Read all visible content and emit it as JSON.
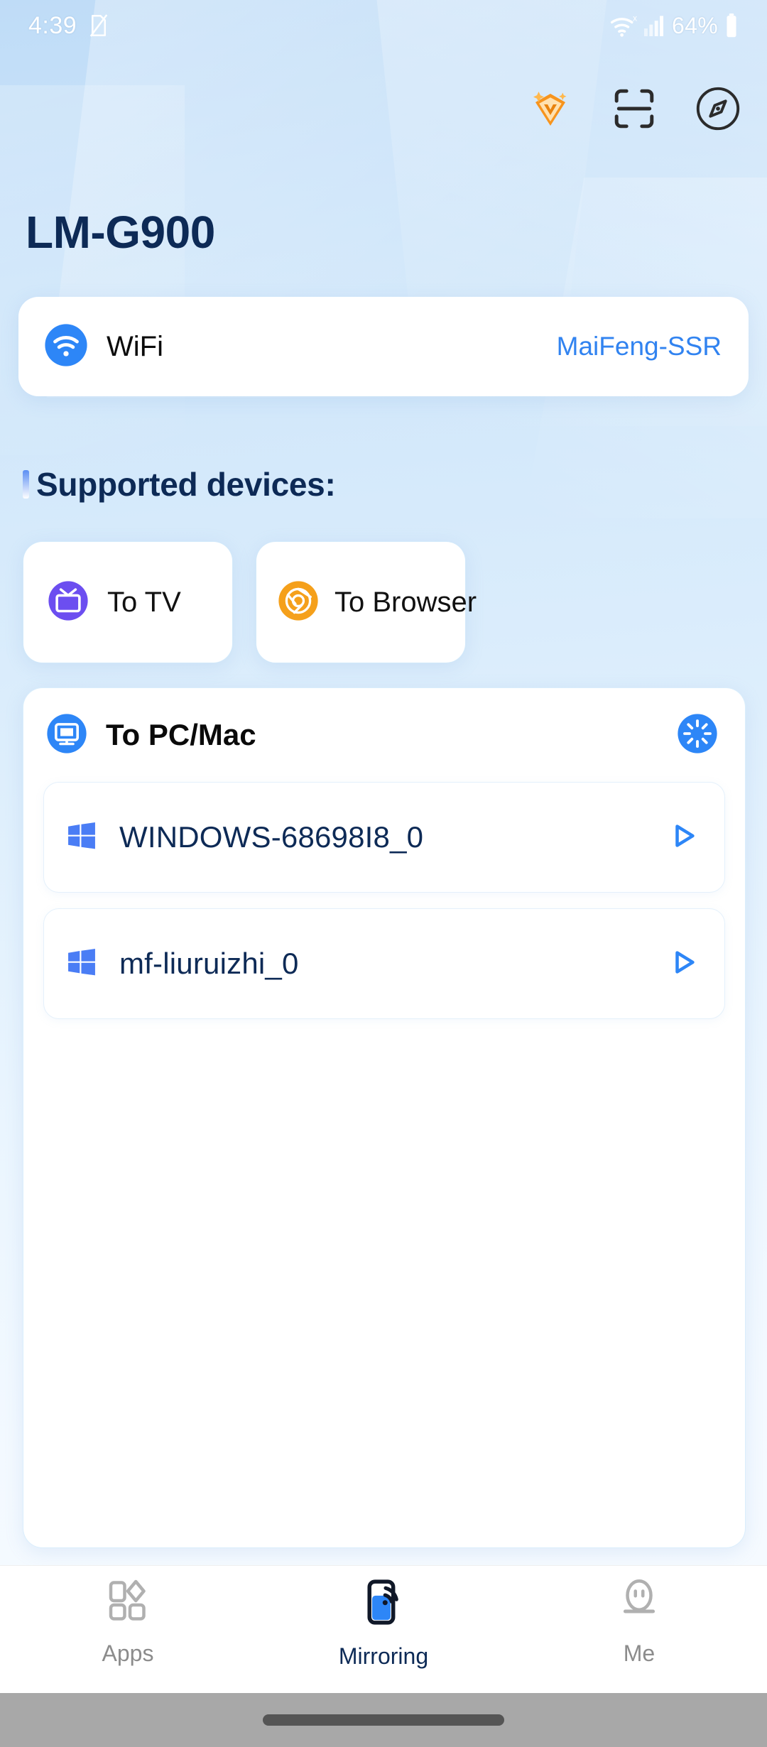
{
  "status_bar": {
    "time": "4:39",
    "no_sim_icon": "no-sim-icon",
    "wifi_icon": "wifi-x-icon",
    "signal_icon": "cellular-signal-icon",
    "battery_percent": "64%",
    "battery_icon": "battery-icon"
  },
  "header": {
    "vip_icon": "vip-diamond-icon",
    "scan_icon": "qr-scan-icon",
    "compass_icon": "compass-icon"
  },
  "device": {
    "name": "LM-G900"
  },
  "wifi": {
    "icon": "wifi-icon",
    "label": "WiFi",
    "ssid": "MaiFeng-SSR",
    "ssid_color": "#3183f0"
  },
  "supported": {
    "heading": "Supported devices:",
    "cards": [
      {
        "label": "To TV",
        "icon": "tv-icon",
        "icon_color": "#6c4ef0"
      },
      {
        "label": "To Browser",
        "icon": "browser-chrome-icon",
        "icon_color": "#f5a01b"
      }
    ]
  },
  "pcmac": {
    "title": "To PC/Mac",
    "icon": "monitor-icon",
    "icon_color": "#2d86f7",
    "refresh_icon": "loading-spinner-icon",
    "devices": [
      {
        "name": "WINDOWS-68698I8_0",
        "platform_icon": "windows-icon",
        "action_icon": "play-icon"
      },
      {
        "name": "mf-liuruizhi_0",
        "platform_icon": "windows-icon",
        "action_icon": "play-icon"
      }
    ]
  },
  "bottom_nav": {
    "active": "Mirroring",
    "items": [
      {
        "label": "Apps",
        "icon": "apps-grid-icon"
      },
      {
        "label": "Mirroring",
        "icon": "screen-mirroring-icon"
      },
      {
        "label": "Me",
        "icon": "profile-icon"
      }
    ]
  },
  "system": {
    "gesture_bar": "home-gesture-bar"
  },
  "colors": {
    "accent_blue": "#2d86f7",
    "title_navy": "#0d2a56",
    "bg_top": "#bfdcf7",
    "bg_bottom": "#f7fbff"
  }
}
